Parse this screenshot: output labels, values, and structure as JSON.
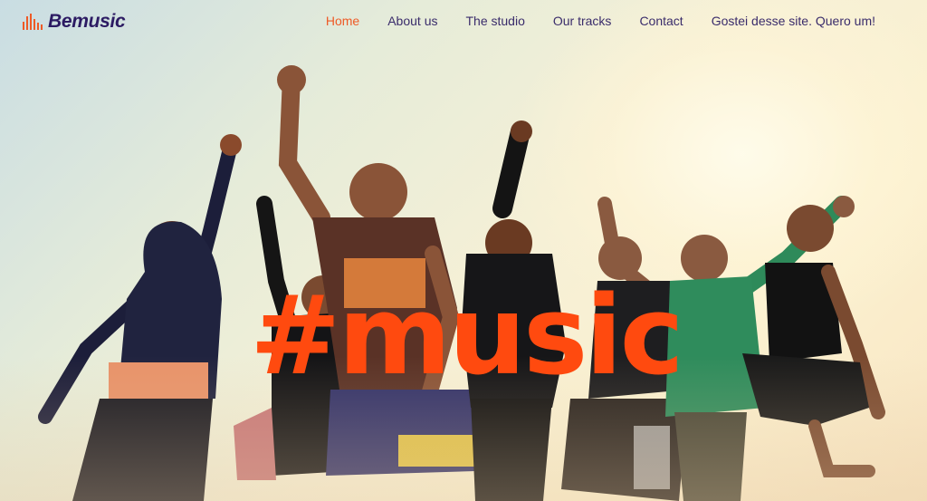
{
  "brand": {
    "name": "Bemusic",
    "icon": "equalizer-bars-icon",
    "color": "#2c1b63",
    "accent": "#ee5a26"
  },
  "nav": {
    "items": [
      {
        "label": "Home",
        "active": true
      },
      {
        "label": "About us",
        "active": false
      },
      {
        "label": "The studio",
        "active": false
      },
      {
        "label": "Our tracks",
        "active": false
      },
      {
        "label": "Contact",
        "active": false
      },
      {
        "label": "Gostei desse site. Quero um!",
        "active": false
      }
    ],
    "active_color": "#ee5a26",
    "text_color": "#3a2c6b"
  },
  "hero": {
    "headline": "#music",
    "headline_color": "#ff4a0f",
    "image": "group-jumping-at-sunset-photo"
  }
}
